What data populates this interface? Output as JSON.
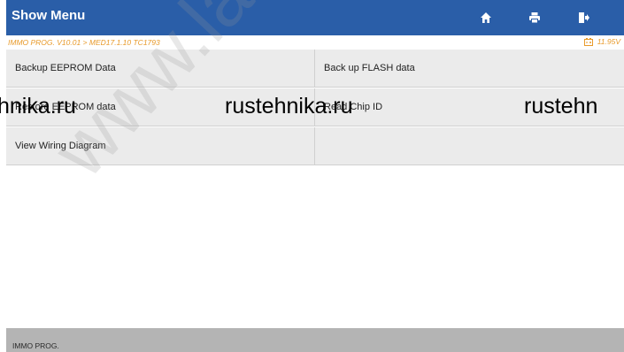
{
  "header": {
    "title": "Show Menu",
    "icons": [
      "home-icon",
      "print-icon",
      "exit-icon"
    ],
    "background": "#2a5ea8"
  },
  "subheader": {
    "breadcrumb": "IMMO PROG. V10.01 > MED17.1.10 TC1793",
    "voltage": "11.95V",
    "color": "#e89a2a"
  },
  "menu": {
    "items": [
      {
        "label": "Backup EEPROM Data"
      },
      {
        "label": "Back up FLASH data"
      },
      {
        "label": "Restore EEPROM data"
      },
      {
        "label": "Read Chip ID"
      },
      {
        "label": "View Wiring Diagram"
      },
      {
        "label": ""
      }
    ]
  },
  "footer": {
    "label": "IMMO PROG."
  },
  "watermarks": {
    "band": [
      "hnika.ru",
      "rustehnika.ru",
      "rustehn"
    ],
    "diagonal": "www.launch"
  }
}
